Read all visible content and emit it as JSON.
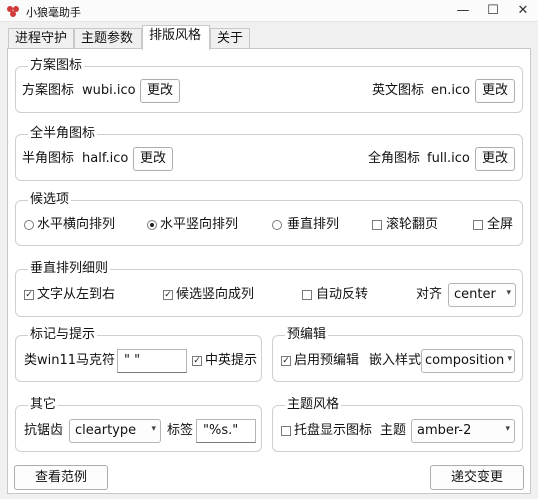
{
  "window": {
    "title": "小狼毫助手",
    "minimize": "—",
    "maximize": "☐",
    "close": "✕",
    "accent": "#d03a3a"
  },
  "tabs": [
    "进程守护",
    "主题参数",
    "排版风格",
    "关于"
  ],
  "scheme_icon": {
    "legend": "方案图标",
    "scheme_label": "方案图标",
    "scheme_value": "wubi.ico",
    "scheme_btn": "更改",
    "en_label": "英文图标",
    "en_value": "en.ico",
    "en_btn": "更改"
  },
  "width_icon": {
    "legend": "全半角图标",
    "half_label": "半角图标",
    "half_value": "half.ico",
    "half_btn": "更改",
    "full_label": "全角图标",
    "full_value": "full.ico",
    "full_btn": "更改"
  },
  "candidates": {
    "legend": "候选项",
    "options": [
      {
        "label": "水平横向排列",
        "selected": false
      },
      {
        "label": "水平竖向排列",
        "selected": true
      },
      {
        "label": "垂直排列",
        "selected": false
      }
    ],
    "scroll_label": "滚轮翻页",
    "scroll_checked": false,
    "fullscreen_label": "全屏",
    "fullscreen_checked": false
  },
  "vertical": {
    "legend": "垂直排列细则",
    "ltr_label": "文字从左到右",
    "ltr_checked": true,
    "vcol_label": "候选竖向成列",
    "vcol_checked": true,
    "rev_label": "自动反转",
    "rev_checked": false,
    "align_label": "对齐",
    "align_value": "center"
  },
  "markers": {
    "legend": "标记与提示",
    "mark_label": "类win11马克符",
    "mark_value": "\" \"",
    "hint_label": "中英提示",
    "hint_checked": true
  },
  "preedit": {
    "legend": "预编辑",
    "enable_label": "启用预编辑",
    "enable_checked": true,
    "style_label": "嵌入样式",
    "style_value": "composition"
  },
  "other": {
    "legend": "其它",
    "aa_label": "抗锯齿",
    "aa_value": "cleartype",
    "tag_label": "标签",
    "tag_value": "\"%s.\""
  },
  "theme": {
    "legend": "主题风格",
    "tray_label": "托盘显示图标",
    "tray_checked": false,
    "theme_label": "主题",
    "theme_value": "amber-2"
  },
  "footer": {
    "example_btn": "查看范例",
    "submit_btn": "递交变更"
  }
}
